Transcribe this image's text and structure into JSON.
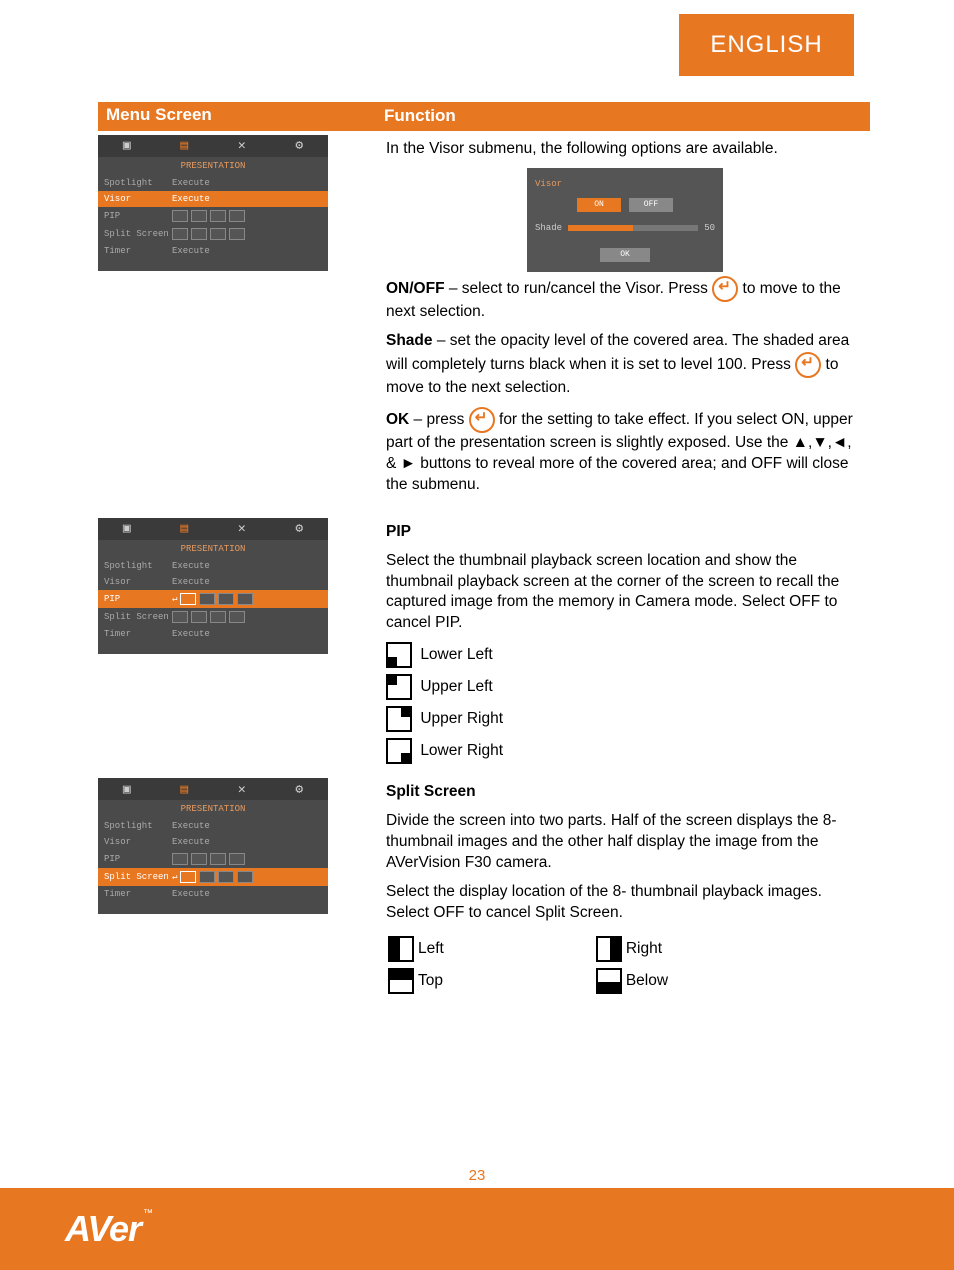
{
  "header": {
    "language": "ENGLISH"
  },
  "table_headers": {
    "col1": "Menu Screen",
    "col2": "Function"
  },
  "visor": {
    "intro": "In the Visor submenu, the following options are available.",
    "popup": {
      "title": "Visor",
      "on": "ON",
      "off": "OFF",
      "shade_label": "Shade",
      "shade_value": "50",
      "ok": "OK"
    },
    "onoff_b": "ON/OFF",
    "onoff_t": " – select to run/cancel the Visor. Press ",
    "onoff_t2": " to move to the next selection.",
    "shade_b": "Shade",
    "shade_t": " – set the opacity level of the covered area. The shaded area will completely turns black when it is set to level 100. Press ",
    "shade_t2": " to move to the next selection.",
    "ok_b": "OK",
    "ok_t": " – press ",
    "ok_t2": " for the setting to take effect.  If you select ON, upper part of the presentation screen is slightly exposed. Use the ▲,▼,◄, & ► buttons to reveal more of the covered area; and OFF will close the submenu."
  },
  "pip": {
    "title": "PIP",
    "body": "Select the thumbnail playback screen location and show the thumbnail playback screen at the corner of the screen to recall the captured image from the memory in Camera mode. Select OFF to cancel PIP.",
    "opts": [
      "Lower Left",
      "Upper Left",
      "Upper Right",
      "Lower Right"
    ]
  },
  "split": {
    "title": "Split Screen",
    "body1": "Divide the screen into two parts. Half of the screen displays the 8-thumbnail images and the other half display the image from the AVerVision F30 camera.",
    "body2": "Select the display location of the 8- thumbnail playback images. Select OFF to cancel Split Screen.",
    "opts": {
      "left": "Left",
      "right": "Right",
      "top": "Top",
      "below": "Below"
    }
  },
  "osd": {
    "title": "PRESENTATION",
    "rows": {
      "spotlight": "Spotlight",
      "visor": "Visor",
      "pip": "PIP",
      "split": "Split Screen",
      "timer": "Timer",
      "execute": "Execute"
    }
  },
  "footer": {
    "page": "23",
    "brand": "AVer",
    "tm": "™"
  }
}
